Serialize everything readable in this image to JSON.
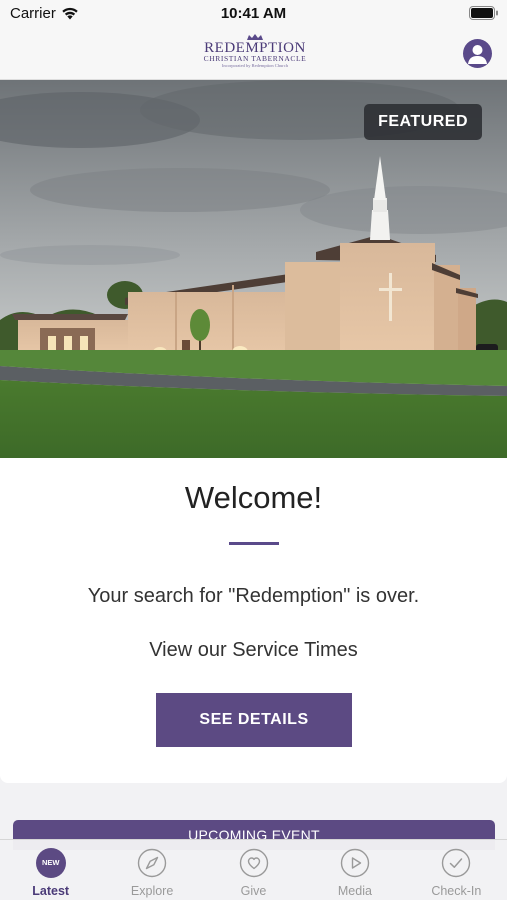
{
  "status_bar": {
    "carrier": "Carrier",
    "time": "10:41 AM"
  },
  "header": {
    "logo": {
      "main": "REDEMPTION",
      "sub": "CHRISTIAN TABERNACLE",
      "tagline": "Incorporated by Redemption Church"
    },
    "profile_icon": "person-icon"
  },
  "hero": {
    "badge": "FEATURED",
    "image": "church-building-photo"
  },
  "welcome_card": {
    "title": "Welcome!",
    "text1": "Your search for \"Redemption\" is over.",
    "text2": "View our Service Times",
    "button": "SEE DETAILS"
  },
  "event_bar": {
    "label": "UPCOMING EVENT"
  },
  "tabs": [
    {
      "label": "Latest",
      "icon": "new-badge-icon",
      "badge": "NEW",
      "active": true
    },
    {
      "label": "Explore",
      "icon": "compass-icon",
      "active": false
    },
    {
      "label": "Give",
      "icon": "heart-icon",
      "active": false
    },
    {
      "label": "Media",
      "icon": "play-icon",
      "active": false
    },
    {
      "label": "Check-In",
      "icon": "checkmark-icon",
      "active": false
    }
  ],
  "colors": {
    "accent": "#5c4a83",
    "badge_bg": "#2d3034",
    "tab_inactive": "#9a9a9a"
  }
}
